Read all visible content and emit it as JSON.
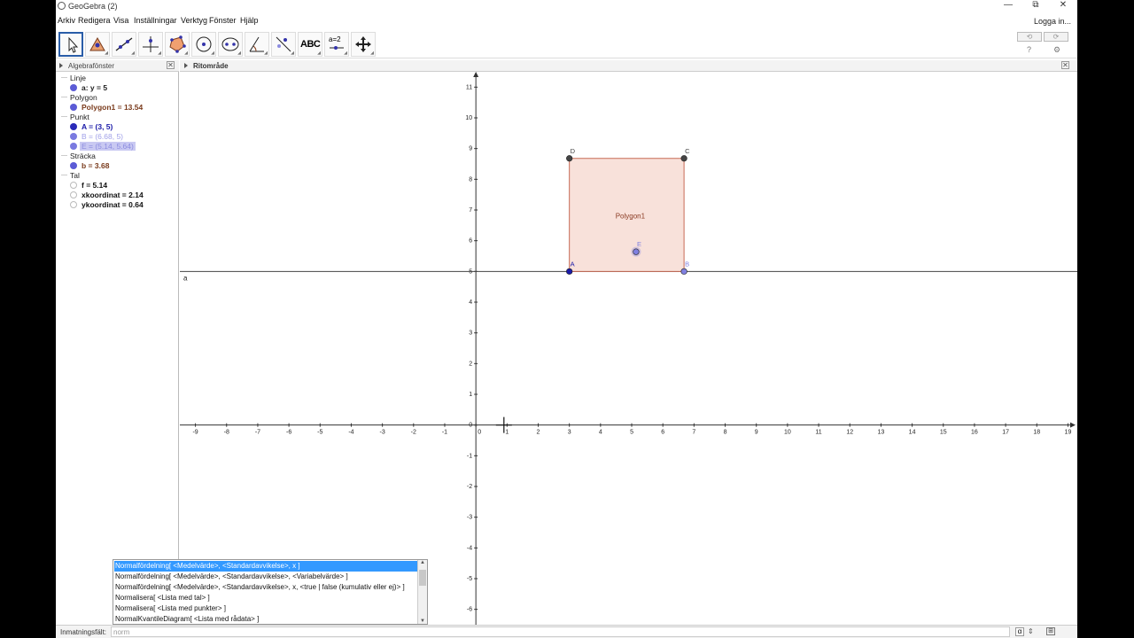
{
  "window": {
    "title": "GeoGebra (2)",
    "controls": {
      "minimize": "—",
      "restore": "⧉",
      "close": "✕"
    }
  },
  "menu": {
    "items": [
      "Arkiv",
      "Redigera",
      "Visa",
      "Inställningar",
      "Verktyg",
      "Fönster",
      "Hjälp"
    ],
    "login": "Logga in..."
  },
  "toolbar": {
    "tools": [
      "move-tool",
      "point-tool",
      "line-tool",
      "perpendicular-tool",
      "polygon-tool",
      "circle-tool",
      "conic-tool",
      "angle-tool",
      "reflect-tool",
      "text-tool",
      "slider-tool",
      "move-view-tool"
    ],
    "text_tool_label": "ABC",
    "slider_tool_label": "a=2",
    "undo_icon": "undo-icon",
    "redo_icon": "redo-icon",
    "help_label": "?",
    "settings_label": "⚙"
  },
  "algebra": {
    "header": "Algebrafönster",
    "categories": {
      "linje": "Linje",
      "polygon": "Polygon",
      "punkt": "Punkt",
      "stracka": "Sträcka",
      "tal": "Tal"
    },
    "objects": {
      "line_a": {
        "text": "a: y = 5",
        "color": "#5b5bd6"
      },
      "polygon1": {
        "text": "Polygon1 = 13.54",
        "color": "#7a3b1c"
      },
      "point_A": {
        "text": "A = (3, 5)",
        "color": "#1a1aa8"
      },
      "point_B": {
        "text": "B = (6.68, 5)",
        "color": "#8c8ce0"
      },
      "point_E": {
        "text": "E = (5.14, 5.64)",
        "color": "#8c8ce0"
      },
      "segment_b": {
        "text": "b = 3.68",
        "color": "#7a3b1c"
      },
      "num_f": {
        "text": "f = 5.14"
      },
      "xkoordinat": {
        "text": "xkoordinat = 2.14"
      },
      "ykoordinat": {
        "text": "ykoordinat = 0.64"
      }
    }
  },
  "graphics": {
    "header": "Ritområde",
    "line_label": "a",
    "polygon_label": "Polygon1",
    "points": [
      {
        "name": "A",
        "x": 3,
        "y": 5,
        "color": "#1a1aa8"
      },
      {
        "name": "B",
        "x": 6.68,
        "y": 5,
        "color": "#8080e0"
      },
      {
        "name": "C",
        "x": 6.68,
        "y": 8.68,
        "color": "#444444"
      },
      {
        "name": "D",
        "x": 3,
        "y": 8.68,
        "color": "#444444"
      },
      {
        "name": "E",
        "x": 5.14,
        "y": 5.64,
        "color": "#8080e0"
      }
    ],
    "line_a_y": 5,
    "x_range": [
      -9.5,
      19.3
    ],
    "y_range": [
      -6.5,
      11.5
    ],
    "x_ticks": [
      -9,
      -8,
      -7,
      -6,
      -5,
      -4,
      -3,
      -2,
      -1,
      0,
      1,
      2,
      3,
      4,
      5,
      6,
      7,
      8,
      9,
      10,
      11,
      12,
      13,
      14,
      15,
      16,
      17,
      18,
      19
    ],
    "y_ticks": [
      -6,
      -5,
      -4,
      -3,
      -2,
      -1,
      0,
      1,
      2,
      3,
      4,
      5,
      6,
      7,
      8,
      9,
      10,
      11
    ],
    "cursor": {
      "x": 0.9,
      "y": 0
    }
  },
  "input": {
    "label": "Inmatningsfält:",
    "value": "norm",
    "alpha_label": "α",
    "spin": "⇕",
    "help_icon": "help-icon"
  },
  "suggestions": [
    "Normalfördelning[ <Medelvärde>, <Standardavvikelse>, x ]",
    "Normalfördelning[ <Medelvärde>, <Standardavvikelse>, <Variabelvärde> ]",
    "Normalfördelning[ <Medelvärde>, <Standardavvikelse>, x, <true | false (kumulativ eller ej)> ]",
    "Normalisera[ <Lista med tal> ]",
    "Normalisera[ <Lista med punkter> ]",
    "NormalKvantileDiagram[ <Lista med rådata> ]"
  ]
}
